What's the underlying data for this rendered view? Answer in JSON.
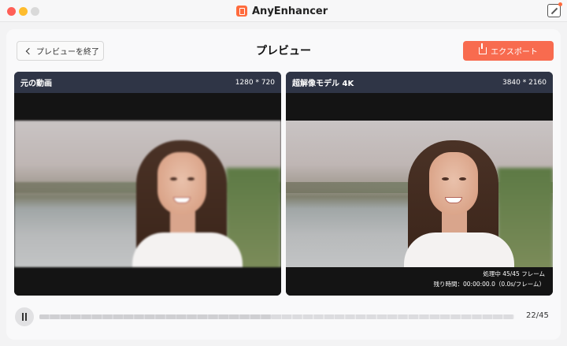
{
  "window": {
    "app_name": "AnyEnhancer"
  },
  "header": {
    "back_label": "プレビューを終了",
    "title": "プレビュー",
    "export_label": "エクスポート"
  },
  "panels": [
    {
      "label": "元の動画",
      "resolution": "1280 * 720"
    },
    {
      "label": "超解像モデル 4K",
      "resolution": "3840 * 2160"
    }
  ],
  "processing": {
    "frames_line": "処理中 45/45 フレーム",
    "time_line": "残り時間：00:00:00.0（0.0s/フレーム）"
  },
  "playback": {
    "current_frame": 22,
    "total_frames": 45,
    "progress_fraction": 0.489,
    "counter_text": "22/45"
  },
  "colors": {
    "accent": "#f86b4f",
    "panel_header": "#2f3546"
  },
  "icons": {
    "back": "chevron-left-icon",
    "export": "export-icon",
    "pause": "pause-icon",
    "edit": "edit-feedback-icon"
  }
}
